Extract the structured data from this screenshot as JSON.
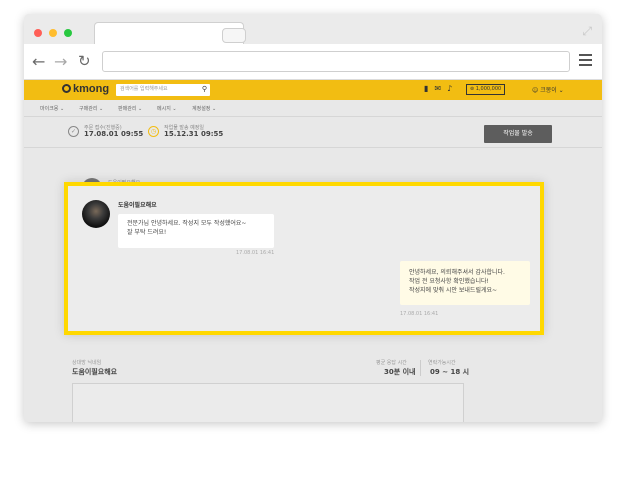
{
  "colors": {
    "accent": "#f2bd12",
    "highlight": "#ffd800",
    "button": "#5d5d5d"
  },
  "browser": {
    "tab_close": "×",
    "expand_icon": "expand-icon"
  },
  "header": {
    "logo": "kmong",
    "search_placeholder": "검색어를 입력해주세요",
    "credit": "1,000,000",
    "user": "크몽이"
  },
  "subnav": {
    "items": [
      "마이크몽",
      "구매관리",
      "판매관리",
      "메시지",
      "계정설정"
    ]
  },
  "order": {
    "received_label": "주문 접수(진행중)",
    "received_value": "17.08.01 09:55",
    "deadline_label": "작업물 발송 예정일",
    "deadline_value": "15.12.31 09:55",
    "submit_label": "작업물 발송"
  },
  "background": {
    "name": "도움이필요해요"
  },
  "chat": {
    "name": "도움이필요해요",
    "incoming": {
      "lines": [
        "전문가님 안녕하세요. 작성지 모두 작성했어요~",
        "잘 부탁 드려요!"
      ],
      "time": "17.08.01 16:41"
    },
    "outgoing": {
      "lines": [
        "안녕하세요, 의뢰해주셔서 감사합니다.",
        "작업 전 요청사항 확인했습니다!",
        "작성지에 맞춰 시안 보내드릴게요~"
      ],
      "time": "17.08.01 16:41"
    }
  },
  "bottom": {
    "nick_label": "상대방 닉네임",
    "nick_value": "도움이필요해요",
    "response_label": "평균 응답 시간",
    "response_value": "30분 이내",
    "contact_label": "연락가능시간",
    "contact_value": "09 ~ 18 시"
  }
}
